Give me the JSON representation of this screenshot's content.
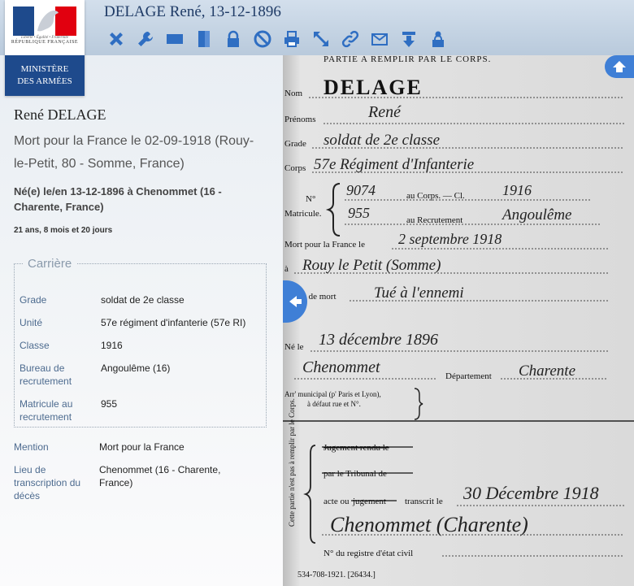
{
  "header": {
    "title": "DELAGE René, 13-12-1896",
    "logo": {
      "republic_motto": "Liberté • Égalité • Fraternité",
      "republic": "RÉPUBLIQUE FRANÇAISE",
      "ministry_line1": "MINISTÈRE",
      "ministry_line2": "DES ARMÉES"
    },
    "toolbar_icons": [
      "close-icon",
      "wrench-icon",
      "fit-width-icon",
      "fit-height-icon",
      "lock-icon",
      "ban-icon",
      "print-icon",
      "resize-icon",
      "link-icon",
      "mail-icon",
      "download-icon",
      "account-lock-icon"
    ],
    "accent_color": "#2f6ec2"
  },
  "person": {
    "name": "René DELAGE",
    "death": "Mort pour la France le 02-09-1918 (Rouy-le-Petit, 80 - Somme, France)",
    "birth": "Né(e) le/en 13-12-1896 à Chenommet (16 - Charente, France)",
    "age": "21 ans, 8 mois et 20 jours"
  },
  "carriere": {
    "legend": "Carrière",
    "rows": [
      {
        "label": "Grade",
        "value": "soldat de 2e classe"
      },
      {
        "label": "Unité",
        "value": "57e régiment d'infanterie (57e RI)"
      },
      {
        "label": "Classe",
        "value": "1916"
      },
      {
        "label": "Bureau de recrutement",
        "value": "Angoulême (16)"
      },
      {
        "label": "Matricule au recrutement",
        "value": "955"
      }
    ]
  },
  "extra": [
    {
      "label": "Mention",
      "value": "Mort pour la France"
    },
    {
      "label": "Lieu de transcription du décès",
      "value": "Chenommet (16 - Charente, France)"
    }
  ],
  "scan": {
    "header": "PARTIE A REMPLIR PAR LE CORPS.",
    "nom_label": "Nom",
    "nom": "DELAGE",
    "prenoms_label": "Prénoms",
    "prenoms": "René",
    "grade_label": "Grade",
    "grade": "soldat de 2e classe",
    "corps_label": "Corps",
    "corps": "57e Régiment d'Infanterie",
    "no_label": "N°",
    "matricule_label": "Matricule.",
    "no_corps": "9074",
    "au_corps": "au Corps. — Cl.",
    "classe": "1916",
    "no_recrut": "955",
    "au_recrut": "au Recrutement",
    "recrut": "Angoulême",
    "mort_label": "Mort pour la France le",
    "mort_date": "2 septembre 1918",
    "a_label": "à",
    "lieu": "Rouy le Petit (Somme)",
    "genre_label": "Genre de mort",
    "genre": "Tué à l'ennemi",
    "ne_label": "Né le",
    "ne_date": "13 décembre 1896",
    "ne_lieu": "Chenommet",
    "dept_label": "Département",
    "dept": "Charente",
    "arr_label": "Arr' municipal (p' Paris et Lyon),",
    "arr_label2": "à défaut rue et N°.",
    "side_note": "Cette partie n'est pas à remplir par le Corps.",
    "jugement": "Jugement rendu le",
    "tribunal": "par le Tribunal de",
    "acte_a": "acte ou",
    "acte_b": "jugement",
    "acte_c": "transcrit le",
    "transcrit_date": "30 Décembre 1918",
    "transcrit_lieu": "Chenommet (Charente)",
    "registre": "N° du registre d'état civil",
    "footer": "534-708-1921. [26434.]"
  }
}
